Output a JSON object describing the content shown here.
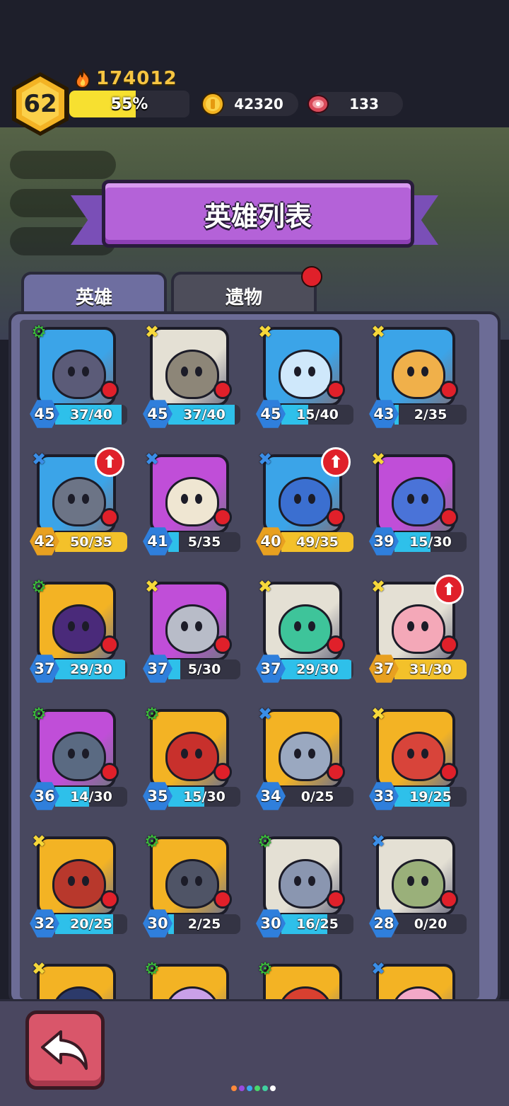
{
  "player": {
    "level": "62",
    "power": "174012",
    "xp_percent_label": "55%",
    "xp_fraction": 0.55
  },
  "resources": {
    "coins": "42320",
    "meat": "133"
  },
  "title": "英雄列表",
  "tabs": [
    {
      "label": "英雄",
      "active": true
    },
    {
      "label": "遗物",
      "active": false,
      "notification": true
    }
  ],
  "colors": {
    "accent_gold": "#f6c542",
    "banner_purple": "#b462d8",
    "progress_cyan": "#2ec0ea",
    "progress_gold": "#f3c12a",
    "level_blue": "#2f7fdc",
    "level_gold": "#e8a020",
    "notification_red": "#e0202a"
  },
  "heroes": [
    {
      "level": "45",
      "shards": "37/40",
      "fill": 0.925,
      "rarity": "green",
      "frame": "blue",
      "body": "#5b5b78",
      "notify": true,
      "upgrade": false,
      "ready": false
    },
    {
      "level": "45",
      "shards": "37/40",
      "fill": 0.925,
      "rarity": "yellow",
      "frame": "white",
      "body": "#8d8678",
      "notify": true,
      "upgrade": false,
      "ready": false
    },
    {
      "level": "45",
      "shards": "15/40",
      "fill": 0.375,
      "rarity": "yellow",
      "frame": "blue",
      "body": "#cfe8fb",
      "notify": true,
      "upgrade": false,
      "ready": false
    },
    {
      "level": "43",
      "shards": "2/35",
      "fill": 0.057,
      "rarity": "yellow",
      "frame": "blue",
      "body": "#f0b04a",
      "notify": true,
      "upgrade": false,
      "ready": false
    },
    {
      "level": "42",
      "shards": "50/35",
      "fill": 1.0,
      "rarity": "blue",
      "frame": "blue",
      "body": "#6c7486",
      "notify": true,
      "upgrade": true,
      "ready": true
    },
    {
      "level": "41",
      "shards": "5/35",
      "fill": 0.143,
      "rarity": "blue",
      "frame": "purple",
      "body": "#efe6d2",
      "notify": true,
      "upgrade": false,
      "ready": false
    },
    {
      "level": "40",
      "shards": "49/35",
      "fill": 1.0,
      "rarity": "blue",
      "frame": "blue",
      "body": "#3b6fd0",
      "notify": true,
      "upgrade": true,
      "ready": true
    },
    {
      "level": "39",
      "shards": "15/30",
      "fill": 0.5,
      "rarity": "yellow",
      "frame": "purple",
      "body": "#4a73d8",
      "notify": true,
      "upgrade": false,
      "ready": false
    },
    {
      "level": "37",
      "shards": "29/30",
      "fill": 0.967,
      "rarity": "green",
      "frame": "gold",
      "body": "#4a2a7a",
      "notify": true,
      "upgrade": false,
      "ready": false
    },
    {
      "level": "37",
      "shards": "5/30",
      "fill": 0.167,
      "rarity": "yellow",
      "frame": "purple",
      "body": "#b8bcc8",
      "notify": true,
      "upgrade": false,
      "ready": false
    },
    {
      "level": "37",
      "shards": "29/30",
      "fill": 0.967,
      "rarity": "yellow",
      "frame": "white",
      "body": "#3ec49a",
      "notify": true,
      "upgrade": false,
      "ready": false
    },
    {
      "level": "37",
      "shards": "31/30",
      "fill": 1.0,
      "rarity": "yellow",
      "frame": "white",
      "body": "#f4a8b8",
      "notify": true,
      "upgrade": true,
      "ready": true
    },
    {
      "level": "36",
      "shards": "14/30",
      "fill": 0.467,
      "rarity": "green",
      "frame": "purple",
      "body": "#5a6a82",
      "notify": true,
      "upgrade": false,
      "ready": false
    },
    {
      "level": "35",
      "shards": "15/30",
      "fill": 0.5,
      "rarity": "green",
      "frame": "gold",
      "body": "#c8302c",
      "notify": true,
      "upgrade": false,
      "ready": false
    },
    {
      "level": "34",
      "shards": "0/25",
      "fill": 0.0,
      "rarity": "blue",
      "frame": "gold",
      "body": "#9aa8c0",
      "notify": true,
      "upgrade": false,
      "ready": false
    },
    {
      "level": "33",
      "shards": "19/25",
      "fill": 0.76,
      "rarity": "yellow",
      "frame": "gold",
      "body": "#d8443a",
      "notify": true,
      "upgrade": false,
      "ready": false
    },
    {
      "level": "32",
      "shards": "20/25",
      "fill": 0.8,
      "rarity": "yellow",
      "frame": "gold",
      "body": "#b8382c",
      "notify": true,
      "upgrade": false,
      "ready": false
    },
    {
      "level": "30",
      "shards": "2/25",
      "fill": 0.08,
      "rarity": "green",
      "frame": "gold",
      "body": "#4f5466",
      "notify": true,
      "upgrade": false,
      "ready": false
    },
    {
      "level": "30",
      "shards": "16/25",
      "fill": 0.64,
      "rarity": "green",
      "frame": "white",
      "body": "#8a96b0",
      "notify": true,
      "upgrade": false,
      "ready": false
    },
    {
      "level": "28",
      "shards": "0/20",
      "fill": 0.0,
      "rarity": "blue",
      "frame": "white",
      "body": "#9ab07a",
      "notify": true,
      "upgrade": false,
      "ready": false
    },
    {
      "level": "",
      "shards": "",
      "fill": 0,
      "rarity": "yellow",
      "frame": "gold",
      "body": "#2c3a6a",
      "notify": false,
      "upgrade": false,
      "ready": false,
      "partial": true
    },
    {
      "level": "",
      "shards": "",
      "fill": 0,
      "rarity": "green",
      "frame": "gold",
      "body": "#c9a0e8",
      "notify": false,
      "upgrade": false,
      "ready": false,
      "partial": true
    },
    {
      "level": "",
      "shards": "",
      "fill": 0,
      "rarity": "green",
      "frame": "gold",
      "body": "#d84030",
      "notify": false,
      "upgrade": false,
      "ready": false,
      "partial": true
    },
    {
      "level": "",
      "shards": "",
      "fill": 0,
      "rarity": "blue",
      "frame": "gold",
      "body": "#f2a8c8",
      "notify": false,
      "upgrade": false,
      "ready": false,
      "partial": true
    }
  ],
  "icons": {
    "power": "flame-icon",
    "coin": "coin-icon",
    "meat": "meat-icon",
    "back": "back-arrow-icon",
    "upgrade": "upgrade-arrow-icon",
    "rarity_green": "green-skull-gear-icon",
    "rarity_yellow": "yellow-crossbones-icon",
    "rarity_blue": "blue-crossbones-icon"
  },
  "page_dots": [
    "#ff8a3a",
    "#9a4ae0",
    "#3aa8f0",
    "#4ad86a",
    "#40d0a0",
    "#ffffff"
  ]
}
